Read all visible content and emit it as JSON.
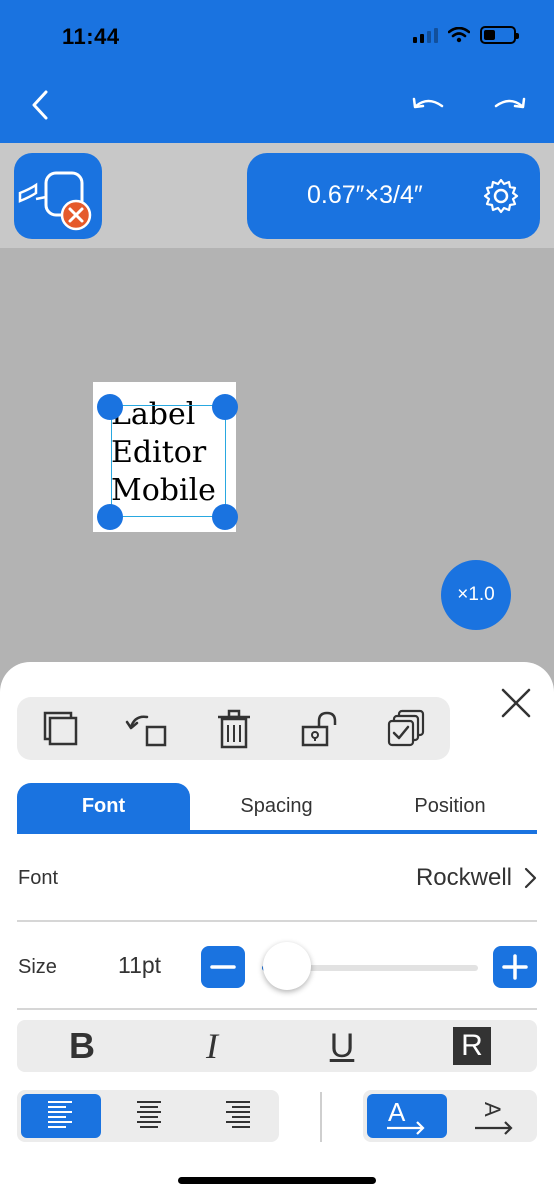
{
  "status_bar": {
    "time": "11:44"
  },
  "toolbar": {
    "label_size": "0.67″×3/4″",
    "icons": [
      "back-icon",
      "undo-icon",
      "redo-icon",
      "device-disconnected-icon",
      "gear-icon"
    ]
  },
  "canvas": {
    "label_lines": [
      "Label",
      "Editor",
      "Mobile"
    ],
    "zoom": "×1.0"
  },
  "sheet": {
    "tools": [
      "duplicate-icon",
      "rotate-icon",
      "delete-icon",
      "lock-icon",
      "multi-select-icon"
    ],
    "tabs": [
      {
        "label": "Font",
        "active": true
      },
      {
        "label": "Spacing",
        "active": false
      },
      {
        "label": "Position",
        "active": false
      }
    ],
    "font_row": {
      "label": "Font",
      "value": "Rockwell"
    },
    "size_row": {
      "label": "Size",
      "value": "11pt",
      "slider_fraction": 0.02
    },
    "style_buttons": {
      "bold": "B",
      "italic": "I",
      "underline": "U",
      "reverse": "R"
    },
    "alignment": {
      "selected": "left",
      "options": [
        "left",
        "center",
        "right"
      ]
    },
    "text_direction": {
      "selected": "horizontal",
      "options": [
        "horizontal",
        "vertical"
      ]
    }
  },
  "colors": {
    "accent": "#1a73e0",
    "canvas_bg": "#b3b3b3"
  }
}
